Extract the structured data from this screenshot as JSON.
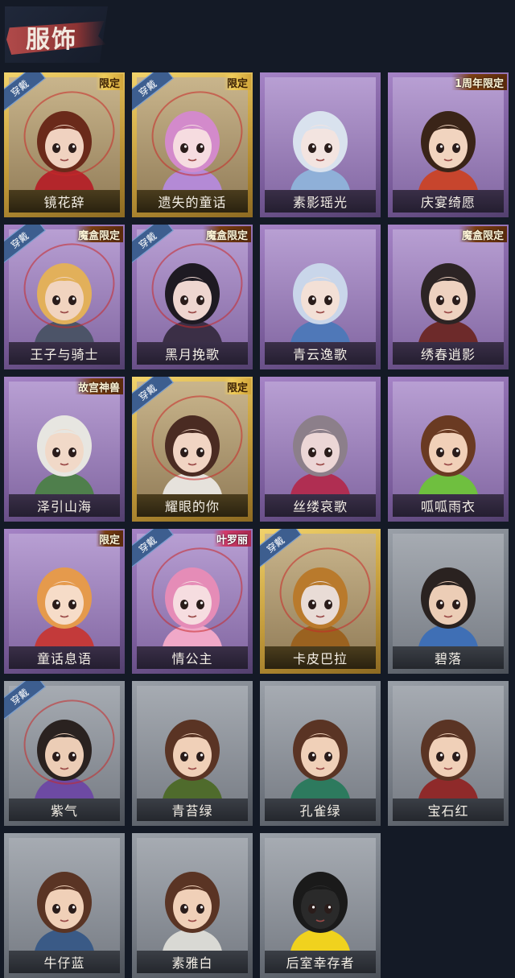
{
  "header": {
    "title": "服饰"
  },
  "labels": {
    "worn": "穿戴"
  },
  "colors": {
    "gold": "#d9b24e",
    "purple": "#7a5c9b",
    "gray": "#6f757e",
    "background": "#141a26",
    "worn_tag": "#3d5e8f"
  },
  "cards": [
    {
      "name": "镜花辞",
      "rarity": "gold",
      "worn": true,
      "badge": "限定",
      "badge_style": "gold",
      "hair": "#6a2a1a",
      "accent": "#b3262b",
      "skin": "#f0d2c0"
    },
    {
      "name": "遗失的童话",
      "rarity": "gold",
      "worn": true,
      "badge": "限定",
      "badge_style": "gold",
      "hair": "#d38acb",
      "accent": "#b48ad6",
      "skin": "#f6dce0"
    },
    {
      "name": "素影瑶光",
      "rarity": "purple",
      "worn": false,
      "badge": "",
      "badge_style": "",
      "hair": "#d9e2ee",
      "accent": "#8fb0d8",
      "skin": "#f3e4e0"
    },
    {
      "name": "庆宴绮愿",
      "rarity": "purple",
      "worn": false,
      "badge": "1周年限定",
      "badge_style": "gold",
      "hair": "#3a2418",
      "accent": "#c7452d",
      "skin": "#f1d4bf"
    },
    {
      "name": "王子与骑士",
      "rarity": "purple",
      "worn": true,
      "badge": "魔盒限定",
      "badge_style": "gold",
      "hair": "#e2b05a",
      "accent": "#4c5468",
      "skin": "#f1d4bf"
    },
    {
      "name": "黑月挽歌",
      "rarity": "purple",
      "worn": true,
      "badge": "魔盒限定",
      "badge_style": "gold",
      "hair": "#1e1a22",
      "accent": "#3b2f46",
      "skin": "#eed6d0"
    },
    {
      "name": "青云逸歌",
      "rarity": "purple",
      "worn": false,
      "badge": "",
      "badge_style": "",
      "hair": "#c9d6ea",
      "accent": "#4f78b8",
      "skin": "#f3e0d6"
    },
    {
      "name": "绣春逍影",
      "rarity": "purple",
      "worn": false,
      "badge": "魔盒限定",
      "badge_style": "gold",
      "hair": "#2c2424",
      "accent": "#6d2a2a",
      "skin": "#eed2c0"
    },
    {
      "name": "泽引山海",
      "rarity": "purple",
      "worn": false,
      "badge": "故宫神兽",
      "badge_style": "gold",
      "hair": "#e7e6e1",
      "accent": "#4f7f4c",
      "skin": "#f1d9c8"
    },
    {
      "name": "耀眼的你",
      "rarity": "gold",
      "worn": true,
      "badge": "限定",
      "badge_style": "gold",
      "hair": "#4a2b22",
      "accent": "#e6e2dc",
      "skin": "#f1d4c3"
    },
    {
      "name": "丝缕哀歌",
      "rarity": "purple",
      "worn": false,
      "badge": "",
      "badge_style": "",
      "hair": "#8c7f8a",
      "accent": "#b02e52",
      "skin": "#ecd6d6"
    },
    {
      "name": "呱呱雨衣",
      "rarity": "purple",
      "worn": false,
      "badge": "",
      "badge_style": "",
      "hair": "#6a3a22",
      "accent": "#6fbf3f",
      "skin": "#f1d0b8"
    },
    {
      "name": "童话息语",
      "rarity": "purple",
      "worn": false,
      "badge": "限定",
      "badge_style": "gold",
      "hair": "#e59a4c",
      "accent": "#c33a3a",
      "skin": "#f6dcc8"
    },
    {
      "name": "情公主",
      "rarity": "purple",
      "worn": true,
      "badge": "叶罗丽",
      "badge_style": "pink",
      "hair": "#e58cb7",
      "accent": "#f0a8c8",
      "skin": "#f6dde0"
    },
    {
      "name": "卡皮巴拉",
      "rarity": "gold",
      "worn": true,
      "badge": "",
      "badge_style": "",
      "hair": "#b97a2c",
      "accent": "#9a6220",
      "skin": "#e9dcd6"
    },
    {
      "name": "碧落",
      "rarity": "gray",
      "worn": false,
      "badge": "",
      "badge_style": "",
      "hair": "#2a2220",
      "accent": "#3f6fb5",
      "skin": "#eccdb6"
    },
    {
      "name": "紫气",
      "rarity": "gray",
      "worn": true,
      "badge": "",
      "badge_style": "",
      "hair": "#2a2220",
      "accent": "#6d4aa3",
      "skin": "#eccdb6"
    },
    {
      "name": "青苔绿",
      "rarity": "gray",
      "worn": false,
      "badge": "",
      "badge_style": "",
      "hair": "#5a3424",
      "accent": "#4f6b2c",
      "skin": "#f0d0b8"
    },
    {
      "name": "孔雀绿",
      "rarity": "gray",
      "worn": false,
      "badge": "",
      "badge_style": "",
      "hair": "#5a3424",
      "accent": "#2d7a5e",
      "skin": "#f0d0b8"
    },
    {
      "name": "宝石红",
      "rarity": "gray",
      "worn": false,
      "badge": "",
      "badge_style": "",
      "hair": "#5a3424",
      "accent": "#8f2a2a",
      "skin": "#f0d0b8"
    },
    {
      "name": "牛仔蓝",
      "rarity": "gray",
      "worn": false,
      "badge": "",
      "badge_style": "",
      "hair": "#5a3424",
      "accent": "#3a5a86",
      "skin": "#f0d0b8"
    },
    {
      "name": "素雅白",
      "rarity": "gray",
      "worn": false,
      "badge": "",
      "badge_style": "",
      "hair": "#5a3424",
      "accent": "#d9d9d4",
      "skin": "#f0d0b8"
    },
    {
      "name": "后室幸存者",
      "rarity": "gray",
      "worn": false,
      "badge": "",
      "badge_style": "",
      "hair": "#1a1a1a",
      "accent": "#f0d21e",
      "skin": "#2a2a2a"
    }
  ]
}
